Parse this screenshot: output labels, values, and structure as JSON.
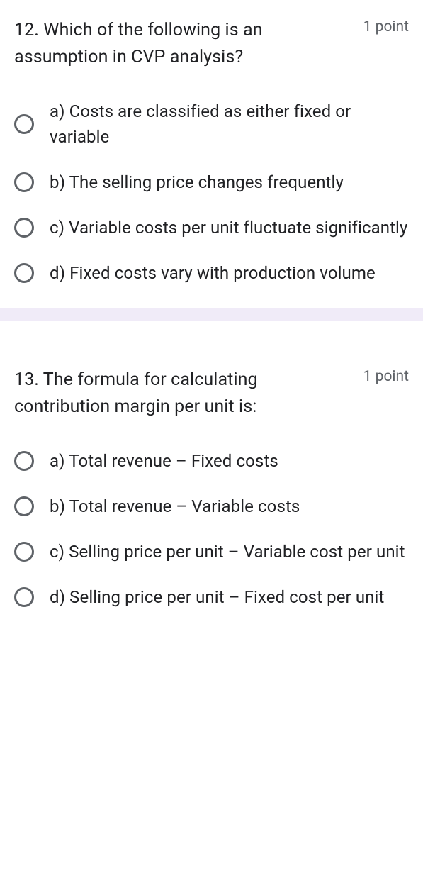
{
  "questions": [
    {
      "text": "12. Which of the following is an assumption in CVP analysis?",
      "points": "1 point",
      "options": [
        "a) Costs are classified as either fixed or variable",
        "b) The selling price changes frequently",
        "c) Variable costs per unit fluctuate significantly",
        "d) Fixed costs vary with production volume"
      ]
    },
    {
      "text": "13. The formula for calculating contribution margin per unit is:",
      "points": "1 point",
      "options": [
        "a) Total revenue – Fixed costs",
        "b) Total revenue – Variable costs",
        "c) Selling price per unit – Variable cost per unit",
        "d) Selling price per unit – Fixed cost per unit"
      ]
    }
  ]
}
